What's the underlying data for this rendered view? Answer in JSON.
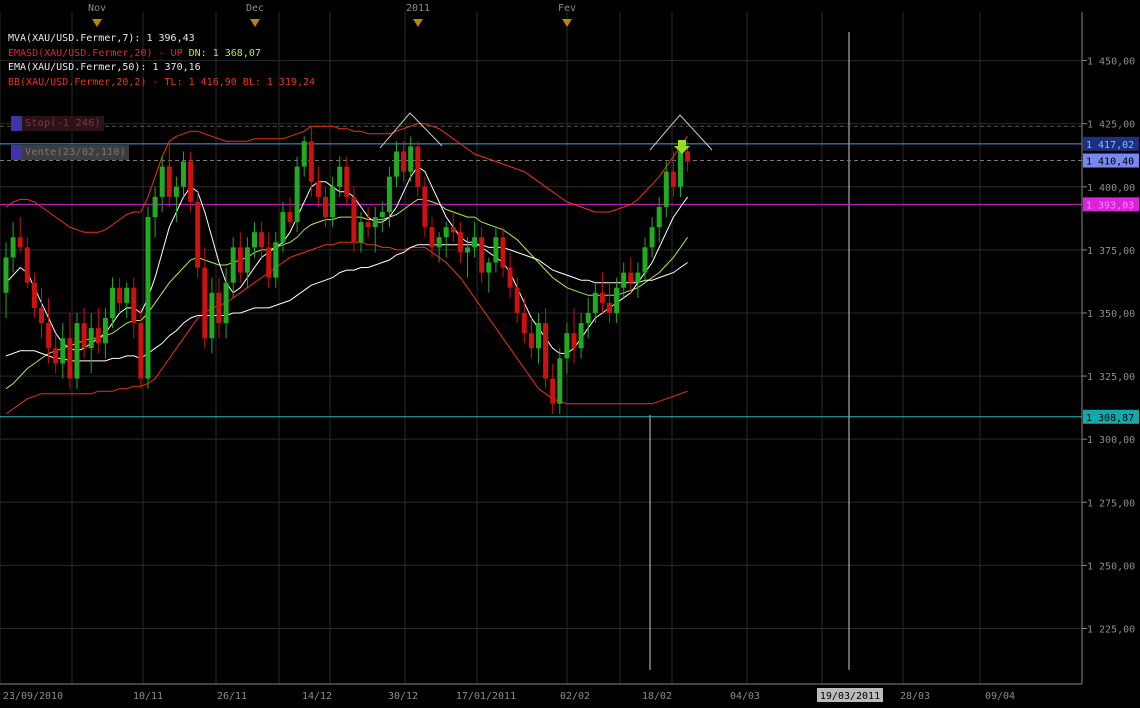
{
  "legend": {
    "mva": "MVA(XAU/USD.Fermer,7): 1 396,43",
    "emasd_main": "EMASD(XAU/USD.Fermer,20) - UP",
    "emasd_dn": "DN: 1 368,07",
    "ema": "EMA(XAU/USD.Fermer,50): 1 370,16",
    "bb": "BB(XAU/USD.Fermer,20,2) - TL: 1 416,90 BL: 1 319,24"
  },
  "orders": {
    "stop": "Stop(-1 246)",
    "sell": "Vente(23/02,110)"
  },
  "price_axis": {
    "ticks": [
      "1 450,00",
      "1 425,00",
      "1 400,00",
      "1 375,00",
      "1 350,00",
      "1 325,00",
      "1 300,00",
      "1 275,00",
      "1 250,00",
      "1 225,00"
    ],
    "tick_values": [
      1450,
      1425,
      1400,
      1375,
      1350,
      1325,
      1300,
      1275,
      1250,
      1225
    ],
    "badges": [
      {
        "label": "1 417,02",
        "value": 1417.02,
        "bg": "#1e2f82",
        "fg": "#66ccff"
      },
      {
        "label": "1 410,40",
        "value": 1410.4,
        "bg": "#7788ee",
        "fg": "#000000"
      },
      {
        "label": "1 393,03",
        "value": 1393.03,
        "bg": "#dd22dd",
        "fg": "#ff88ff"
      },
      {
        "label": "1 308,87",
        "value": 1308.87,
        "bg": "#11aaaa",
        "fg": "#000000"
      }
    ]
  },
  "date_axis": {
    "labels": [
      "23/09/2010",
      "10/11",
      "26/11",
      "14/12",
      "30/12",
      "17/01/2011",
      "02/02",
      "18/02",
      "04/03",
      "19/03/2011",
      "28/03",
      "09/04"
    ],
    "highlighted": "19/03/2011"
  },
  "month_markers": [
    "Nov",
    "Dec",
    "2011",
    "Fev"
  ],
  "horizontal_lines": [
    {
      "value": 1417.02,
      "color": "#5599cc"
    },
    {
      "value": 1393.03,
      "color": "#cc22cc"
    },
    {
      "value": 1308.87,
      "color": "#22bbbb"
    },
    {
      "value": 1410.4,
      "color": "#777777",
      "dashed": true
    },
    {
      "value": 1424,
      "color": "#555555",
      "dashed": true
    }
  ],
  "colors": {
    "bull": "#22aa22",
    "bear": "#cc1111",
    "mva": "#ffffff",
    "ema": "#ffffff",
    "emasd": "#aaee44",
    "bb": "#ee3311",
    "grid": "#2a2a2a"
  },
  "chart_data": {
    "type": "candlestick",
    "instrument": "XAU/USD",
    "ylim": [
      1203,
      1474
    ],
    "candles_ohlc": [
      [
        1358,
        1378,
        1348,
        1372
      ],
      [
        1372,
        1386,
        1366,
        1380
      ],
      [
        1380,
        1388,
        1374,
        1376
      ],
      [
        1376,
        1380,
        1360,
        1362
      ],
      [
        1362,
        1366,
        1348,
        1352
      ],
      [
        1352,
        1360,
        1340,
        1346
      ],
      [
        1346,
        1356,
        1330,
        1336
      ],
      [
        1336,
        1342,
        1326,
        1330
      ],
      [
        1330,
        1346,
        1324,
        1340
      ],
      [
        1340,
        1350,
        1320,
        1324
      ],
      [
        1324,
        1350,
        1320,
        1346
      ],
      [
        1346,
        1352,
        1332,
        1336
      ],
      [
        1336,
        1350,
        1326,
        1344
      ],
      [
        1344,
        1352,
        1334,
        1338
      ],
      [
        1338,
        1352,
        1332,
        1348
      ],
      [
        1348,
        1364,
        1344,
        1360
      ],
      [
        1360,
        1364,
        1350,
        1354
      ],
      [
        1354,
        1362,
        1348,
        1360
      ],
      [
        1360,
        1364,
        1340,
        1346
      ],
      [
        1346,
        1352,
        1320,
        1324
      ],
      [
        1324,
        1392,
        1320,
        1388
      ],
      [
        1388,
        1400,
        1380,
        1396
      ],
      [
        1396,
        1412,
        1390,
        1408
      ],
      [
        1408,
        1418,
        1392,
        1396
      ],
      [
        1396,
        1404,
        1386,
        1400
      ],
      [
        1400,
        1414,
        1396,
        1410
      ],
      [
        1410,
        1414,
        1390,
        1394
      ],
      [
        1394,
        1398,
        1364,
        1368
      ],
      [
        1368,
        1376,
        1336,
        1340
      ],
      [
        1340,
        1364,
        1334,
        1358
      ],
      [
        1358,
        1364,
        1340,
        1346
      ],
      [
        1346,
        1368,
        1340,
        1362
      ],
      [
        1362,
        1380,
        1356,
        1376
      ],
      [
        1376,
        1382,
        1362,
        1366
      ],
      [
        1366,
        1380,
        1360,
        1376
      ],
      [
        1376,
        1386,
        1372,
        1382
      ],
      [
        1382,
        1386,
        1372,
        1376
      ],
      [
        1376,
        1382,
        1360,
        1364
      ],
      [
        1364,
        1382,
        1360,
        1378
      ],
      [
        1378,
        1394,
        1374,
        1390
      ],
      [
        1390,
        1396,
        1384,
        1386
      ],
      [
        1386,
        1412,
        1382,
        1408
      ],
      [
        1408,
        1420,
        1404,
        1418
      ],
      [
        1418,
        1424,
        1396,
        1402
      ],
      [
        1402,
        1408,
        1392,
        1396
      ],
      [
        1396,
        1400,
        1384,
        1388
      ],
      [
        1388,
        1404,
        1384,
        1400
      ],
      [
        1400,
        1412,
        1396,
        1408
      ],
      [
        1408,
        1412,
        1392,
        1396
      ],
      [
        1396,
        1400,
        1374,
        1378
      ],
      [
        1378,
        1390,
        1374,
        1386
      ],
      [
        1386,
        1392,
        1380,
        1384
      ],
      [
        1384,
        1392,
        1374,
        1388
      ],
      [
        1388,
        1394,
        1382,
        1390
      ],
      [
        1390,
        1408,
        1384,
        1404
      ],
      [
        1404,
        1418,
        1400,
        1414
      ],
      [
        1414,
        1418,
        1402,
        1406
      ],
      [
        1406,
        1420,
        1402,
        1416
      ],
      [
        1416,
        1418,
        1396,
        1400
      ],
      [
        1400,
        1404,
        1380,
        1384
      ],
      [
        1384,
        1388,
        1372,
        1376
      ],
      [
        1376,
        1382,
        1370,
        1380
      ],
      [
        1380,
        1386,
        1372,
        1384
      ],
      [
        1384,
        1390,
        1378,
        1382
      ],
      [
        1382,
        1386,
        1370,
        1374
      ],
      [
        1374,
        1380,
        1364,
        1376
      ],
      [
        1376,
        1386,
        1372,
        1380
      ],
      [
        1380,
        1384,
        1362,
        1366
      ],
      [
        1366,
        1372,
        1358,
        1370
      ],
      [
        1370,
        1384,
        1366,
        1380
      ],
      [
        1380,
        1384,
        1364,
        1368
      ],
      [
        1368,
        1374,
        1356,
        1360
      ],
      [
        1360,
        1364,
        1346,
        1350
      ],
      [
        1350,
        1356,
        1338,
        1342
      ],
      [
        1342,
        1348,
        1332,
        1336
      ],
      [
        1336,
        1350,
        1330,
        1346
      ],
      [
        1346,
        1352,
        1320,
        1324
      ],
      [
        1324,
        1330,
        1310,
        1314
      ],
      [
        1314,
        1336,
        1310,
        1332
      ],
      [
        1332,
        1346,
        1326,
        1342
      ],
      [
        1342,
        1352,
        1330,
        1336
      ],
      [
        1336,
        1350,
        1332,
        1346
      ],
      [
        1346,
        1356,
        1340,
        1350
      ],
      [
        1350,
        1362,
        1346,
        1358
      ],
      [
        1358,
        1366,
        1350,
        1354
      ],
      [
        1354,
        1362,
        1346,
        1350
      ],
      [
        1350,
        1364,
        1346,
        1360
      ],
      [
        1360,
        1370,
        1356,
        1366
      ],
      [
        1366,
        1372,
        1358,
        1362
      ],
      [
        1362,
        1370,
        1356,
        1366
      ],
      [
        1366,
        1380,
        1362,
        1376
      ],
      [
        1376,
        1388,
        1372,
        1384
      ],
      [
        1384,
        1396,
        1378,
        1392
      ],
      [
        1392,
        1410,
        1388,
        1406
      ],
      [
        1406,
        1414,
        1396,
        1400
      ],
      [
        1400,
        1418,
        1396,
        1414
      ],
      [
        1414,
        1418,
        1406,
        1410
      ]
    ],
    "series_mva": [
      1362,
      1365,
      1368,
      1366,
      1360,
      1354,
      1348,
      1342,
      1338,
      1336,
      1335,
      1336,
      1338,
      1340,
      1342,
      1346,
      1350,
      1352,
      1352,
      1350,
      1356,
      1364,
      1374,
      1384,
      1390,
      1396,
      1400,
      1398,
      1390,
      1380,
      1370,
      1362,
      1358,
      1360,
      1364,
      1368,
      1372,
      1374,
      1376,
      1378,
      1382,
      1388,
      1394,
      1400,
      1402,
      1402,
      1400,
      1398,
      1398,
      1396,
      1392,
      1388,
      1386,
      1386,
      1388,
      1392,
      1398,
      1404,
      1408,
      1406,
      1400,
      1394,
      1388,
      1384,
      1380,
      1378,
      1378,
      1376,
      1374,
      1372,
      1370,
      1366,
      1360,
      1354,
      1348,
      1344,
      1340,
      1336,
      1334,
      1334,
      1336,
      1340,
      1344,
      1348,
      1350,
      1352,
      1354,
      1356,
      1358,
      1362,
      1366,
      1370,
      1376,
      1382,
      1388,
      1392,
      1396
    ],
    "series_ema50": [
      1333,
      1334,
      1335,
      1335,
      1335,
      1334,
      1333,
      1332,
      1332,
      1331,
      1331,
      1331,
      1331,
      1331,
      1331,
      1332,
      1332,
      1333,
      1333,
      1332,
      1334,
      1336,
      1338,
      1341,
      1343,
      1346,
      1348,
      1349,
      1349,
      1349,
      1349,
      1349,
      1350,
      1350,
      1351,
      1352,
      1352,
      1352,
      1353,
      1354,
      1355,
      1357,
      1359,
      1361,
      1362,
      1363,
      1364,
      1366,
      1367,
      1367,
      1368,
      1368,
      1369,
      1370,
      1371,
      1373,
      1374,
      1376,
      1377,
      1377,
      1377,
      1377,
      1377,
      1377,
      1377,
      1377,
      1377,
      1377,
      1376,
      1376,
      1376,
      1375,
      1374,
      1373,
      1372,
      1371,
      1369,
      1367,
      1366,
      1365,
      1364,
      1363,
      1363,
      1362,
      1362,
      1362,
      1362,
      1362,
      1362,
      1362,
      1363,
      1363,
      1364,
      1365,
      1366,
      1368,
      1370
    ],
    "series_emasd20": [
      1320,
      1322,
      1325,
      1328,
      1330,
      1332,
      1334,
      1335,
      1336,
      1337,
      1338,
      1339,
      1340,
      1340,
      1341,
      1342,
      1344,
      1346,
      1347,
      1347,
      1350,
      1354,
      1358,
      1362,
      1365,
      1368,
      1371,
      1372,
      1371,
      1370,
      1369,
      1369,
      1370,
      1371,
      1372,
      1374,
      1375,
      1375,
      1376,
      1377,
      1378,
      1380,
      1383,
      1385,
      1386,
      1387,
      1387,
      1388,
      1388,
      1388,
      1388,
      1387,
      1387,
      1387,
      1388,
      1389,
      1391,
      1393,
      1395,
      1395,
      1394,
      1393,
      1391,
      1390,
      1389,
      1388,
      1388,
      1386,
      1385,
      1384,
      1383,
      1381,
      1379,
      1376,
      1373,
      1370,
      1367,
      1364,
      1362,
      1360,
      1359,
      1358,
      1357,
      1357,
      1357,
      1357,
      1357,
      1358,
      1359,
      1360,
      1362,
      1364,
      1366,
      1369,
      1372,
      1376,
      1380
    ],
    "series_bb_upper": [
      1392,
      1394,
      1395,
      1395,
      1394,
      1392,
      1390,
      1388,
      1386,
      1384,
      1383,
      1382,
      1382,
      1382,
      1383,
      1385,
      1387,
      1389,
      1390,
      1390,
      1396,
      1404,
      1412,
      1418,
      1420,
      1421,
      1422,
      1422,
      1421,
      1420,
      1419,
      1418,
      1418,
      1418,
      1418,
      1419,
      1419,
      1419,
      1419,
      1419,
      1420,
      1421,
      1422,
      1424,
      1424,
      1424,
      1424,
      1423,
      1423,
      1422,
      1422,
      1421,
      1421,
      1421,
      1421,
      1422,
      1423,
      1424,
      1425,
      1425,
      1424,
      1423,
      1421,
      1419,
      1417,
      1415,
      1413,
      1412,
      1411,
      1410,
      1409,
      1408,
      1407,
      1406,
      1404,
      1402,
      1400,
      1398,
      1396,
      1394,
      1393,
      1392,
      1391,
      1390,
      1390,
      1390,
      1391,
      1392,
      1393,
      1395,
      1398,
      1401,
      1404,
      1408,
      1412,
      1416,
      1420
    ],
    "series_bb_lower": [
      1310,
      1312,
      1314,
      1316,
      1317,
      1318,
      1318,
      1318,
      1318,
      1318,
      1318,
      1318,
      1318,
      1319,
      1319,
      1319,
      1320,
      1320,
      1321,
      1321,
      1322,
      1324,
      1328,
      1332,
      1336,
      1340,
      1344,
      1348,
      1350,
      1352,
      1353,
      1354,
      1356,
      1358,
      1360,
      1362,
      1364,
      1366,
      1368,
      1370,
      1372,
      1373,
      1374,
      1375,
      1376,
      1377,
      1377,
      1378,
      1378,
      1378,
      1378,
      1377,
      1377,
      1376,
      1376,
      1375,
      1375,
      1376,
      1376,
      1376,
      1374,
      1372,
      1370,
      1367,
      1364,
      1360,
      1356,
      1352,
      1348,
      1344,
      1340,
      1336,
      1332,
      1328,
      1324,
      1320,
      1318,
      1316,
      1315,
      1314,
      1314,
      1314,
      1314,
      1314,
      1314,
      1314,
      1314,
      1314,
      1314,
      1314,
      1314,
      1314,
      1315,
      1316,
      1317,
      1318,
      1319
    ]
  }
}
